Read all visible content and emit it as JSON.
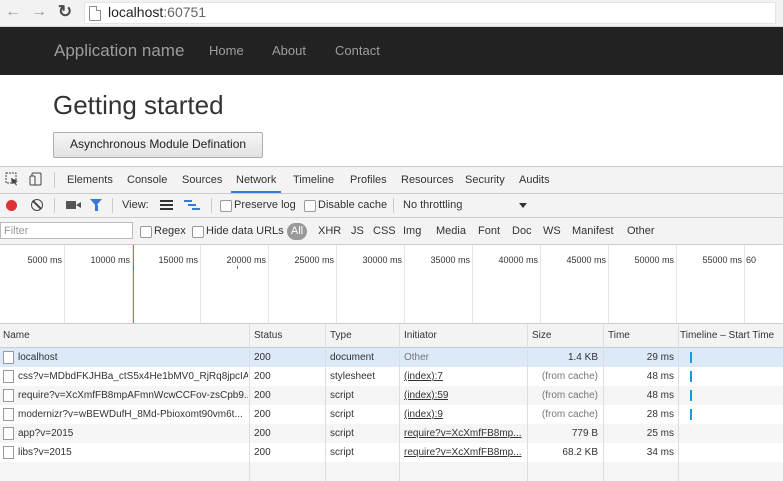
{
  "browser": {
    "url_host": "localhost",
    "url_port": ":60751"
  },
  "app": {
    "brand": "Application name",
    "nav": [
      "Home",
      "About",
      "Contact"
    ],
    "title": "Getting started",
    "button": "Asynchronous Module Defination"
  },
  "devtools": {
    "tabs": [
      "Elements",
      "Console",
      "Sources",
      "Network",
      "Timeline",
      "Profiles",
      "Resources",
      "Security",
      "Audits"
    ],
    "active_tab": "Network",
    "toolbar": {
      "view_label": "View:",
      "preserve_log": "Preserve log",
      "disable_cache": "Disable cache",
      "throttling": "No throttling"
    },
    "filter": {
      "placeholder": "Filter",
      "regex": "Regex",
      "hide_data_urls": "Hide data URLs",
      "types": [
        "All",
        "XHR",
        "JS",
        "CSS",
        "Img",
        "Media",
        "Font",
        "Doc",
        "WS",
        "Manifest",
        "Other"
      ]
    },
    "overview_ticks": [
      "5000 ms",
      "10000 ms",
      "15000 ms",
      "20000 ms",
      "25000 ms",
      "30000 ms",
      "35000 ms",
      "40000 ms",
      "45000 ms",
      "50000 ms",
      "55000 ms",
      "60"
    ],
    "columns": [
      "Name",
      "Status",
      "Type",
      "Initiator",
      "Size",
      "Time",
      "Timeline – Start Time"
    ],
    "requests": [
      {
        "name": "localhost",
        "status": "200",
        "type": "document",
        "initiator": "Other",
        "size": "1.4 KB",
        "time": "29 ms"
      },
      {
        "name": "css?v=MDbdFKJHBa_ctS5x4He1bMV0_RjRq8jpcIA...",
        "status": "200",
        "type": "stylesheet",
        "initiator": "(index):7",
        "size": "(from cache)",
        "time": "48 ms"
      },
      {
        "name": "require?v=XcXmfFB8mpAFmnWcwCCFov-zsCpb9...",
        "status": "200",
        "type": "script",
        "initiator": "(index):59",
        "size": "(from cache)",
        "time": "48 ms"
      },
      {
        "name": "modernizr?v=wBEWDufH_8Md-Pbioxomt90vm6t...",
        "status": "200",
        "type": "script",
        "initiator": "(index):9",
        "size": "(from cache)",
        "time": "28 ms"
      },
      {
        "name": "app?v=2015",
        "status": "200",
        "type": "script",
        "initiator": "require?v=XcXmfFB8mp...",
        "size": "779 B",
        "time": "25 ms"
      },
      {
        "name": "libs?v=2015",
        "status": "200",
        "type": "script",
        "initiator": "require?v=XcXmfFB8mp...",
        "size": "68.2 KB",
        "time": "34 ms"
      }
    ]
  }
}
